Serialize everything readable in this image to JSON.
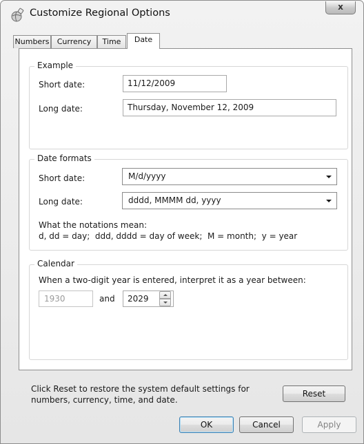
{
  "window": {
    "title": "Customize Regional Options",
    "close_glyph": "x"
  },
  "tabs": [
    {
      "label": "Numbers"
    },
    {
      "label": "Currency"
    },
    {
      "label": "Time"
    },
    {
      "label": "Date"
    }
  ],
  "active_tab": "Date",
  "example": {
    "legend": "Example",
    "short_label": "Short date:",
    "short_value": "11/12/2009",
    "long_label": "Long date:",
    "long_value": "Thursday, November 12, 2009"
  },
  "formats": {
    "legend": "Date formats",
    "short_label": "Short date:",
    "short_value": "M/d/yyyy",
    "long_label": "Long date:",
    "long_value": "dddd, MMMM dd, yyyy",
    "notation_title": "What the notations mean:",
    "notation_text": "d, dd = day;  ddd, dddd = day of week;  M = month;  y = year"
  },
  "calendar": {
    "legend": "Calendar",
    "description": "When a two-digit year is entered, interpret it as a year between:",
    "from_year": "1930",
    "and_label": "and",
    "to_year": "2029"
  },
  "footer": {
    "reset_note": "Click Reset to restore the system default settings for numbers, currency, time, and date.",
    "reset_label": "Reset"
  },
  "buttons": {
    "ok": "OK",
    "cancel": "Cancel",
    "apply": "Apply"
  },
  "colors": {
    "default_button_border": "#3c7fb1",
    "disabled_text": "#9a9a9a"
  }
}
